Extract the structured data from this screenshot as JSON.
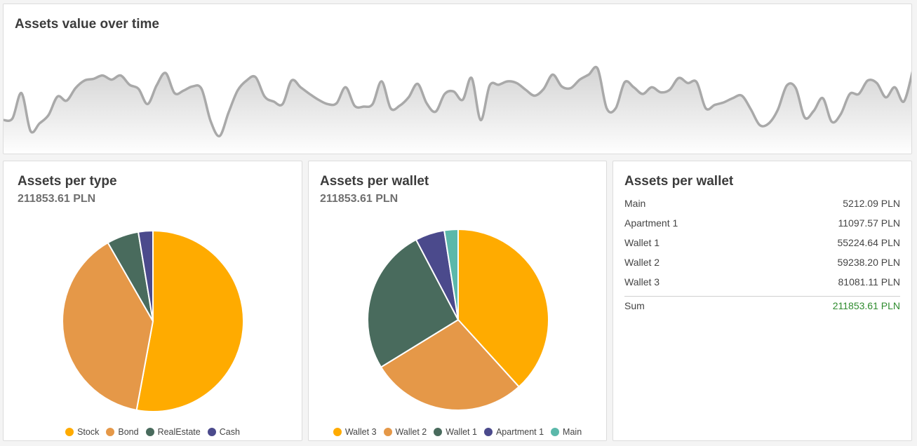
{
  "timeline": {
    "title": "Assets value over time"
  },
  "chart_data": [
    {
      "type": "area",
      "title": "Assets value over time",
      "y": [
        57,
        59,
        89,
        44,
        53,
        63,
        85,
        80,
        95,
        104,
        106,
        110,
        105,
        110,
        99,
        94,
        76,
        98,
        113,
        89,
        92,
        97,
        94,
        56,
        38,
        66,
        92,
        104,
        108,
        85,
        79,
        76,
        104,
        96,
        88,
        81,
        76,
        77,
        96,
        74,
        73,
        76,
        103,
        71,
        74,
        84,
        100,
        77,
        67,
        88,
        91,
        81,
        107,
        57,
        98,
        99,
        103,
        101,
        93,
        86,
        94,
        111,
        97,
        95,
        105,
        111,
        118,
        71,
        71,
        102,
        96,
        88,
        96,
        90,
        93,
        107,
        101,
        102,
        71,
        75,
        78,
        83,
        86,
        70,
        51,
        53,
        69,
        98,
        95,
        60,
        68,
        83,
        55,
        64,
        88,
        88,
        104,
        101,
        84,
        96,
        79,
        116
      ],
      "grid": false,
      "legend": "none"
    },
    {
      "type": "pie",
      "title": "Assets per type",
      "categories": [
        "Stock",
        "Bond",
        "RealEstate",
        "Cash"
      ],
      "values": [
        52.9,
        38.8,
        5.7,
        2.6
      ],
      "colors": [
        "#ffab00",
        "#e59848",
        "#496b5d",
        "#4b4a8c"
      ],
      "legend": "bottom"
    },
    {
      "type": "pie",
      "title": "Assets per wallet",
      "categories": [
        "Wallet 3",
        "Wallet 2",
        "Wallet 1",
        "Apartment 1",
        "Main"
      ],
      "values": [
        81081.11,
        59238.2,
        55224.64,
        11097.57,
        5212.09
      ],
      "colors": [
        "#ffab00",
        "#e59848",
        "#496b5d",
        "#4b4a8c",
        "#5bb8aa"
      ],
      "legend": "bottom"
    }
  ],
  "type_card": {
    "title": "Assets per type",
    "total": "211853.61 PLN",
    "legend": [
      {
        "label": "Stock",
        "color": "#ffab00"
      },
      {
        "label": "Bond",
        "color": "#e59848"
      },
      {
        "label": "RealEstate",
        "color": "#496b5d"
      },
      {
        "label": "Cash",
        "color": "#4b4a8c"
      }
    ]
  },
  "wallet_card": {
    "title": "Assets per wallet",
    "total": "211853.61 PLN",
    "legend": [
      {
        "label": "Wallet 3",
        "color": "#ffab00"
      },
      {
        "label": "Wallet 2",
        "color": "#e59848"
      },
      {
        "label": "Wallet 1",
        "color": "#496b5d"
      },
      {
        "label": "Apartment 1",
        "color": "#4b4a8c"
      },
      {
        "label": "Main",
        "color": "#5bb8aa"
      }
    ]
  },
  "table_card": {
    "title": "Assets per wallet",
    "rows": [
      {
        "name": "Main",
        "value": "5212.09 PLN"
      },
      {
        "name": "Apartment 1",
        "value": "11097.57 PLN"
      },
      {
        "name": "Wallet 1",
        "value": "55224.64 PLN"
      },
      {
        "name": "Wallet 2",
        "value": "59238.20 PLN"
      },
      {
        "name": "Wallet 3",
        "value": "81081.11 PLN"
      }
    ],
    "sum_label": "Sum",
    "sum_value": "211853.61 PLN",
    "sum_color": "#2e8b2e"
  }
}
